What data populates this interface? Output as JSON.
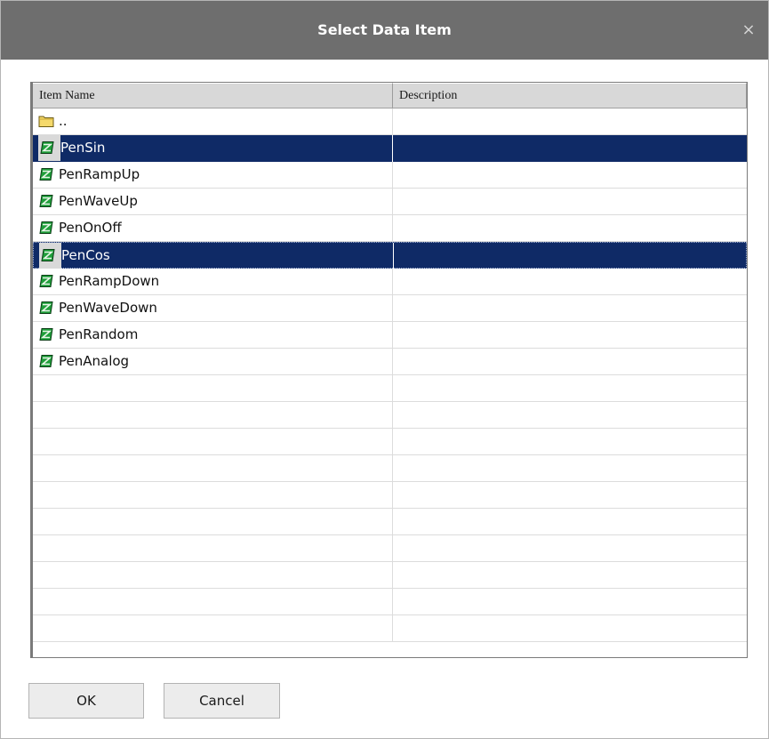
{
  "window": {
    "title": "Select Data Item",
    "close_glyph": "×"
  },
  "colors": {
    "titlebar": "#6e6e6e",
    "selection": "#0f2a66",
    "folder_icon": "#f5d96b",
    "item_icon": "#1f9e3a"
  },
  "list": {
    "columns": [
      "Item Name",
      "Description"
    ],
    "rows": [
      {
        "icon": "folder-icon",
        "name": "..",
        "description": "",
        "selected": false
      },
      {
        "icon": "data-item-icon",
        "name": "PenSin",
        "description": "",
        "selected": true
      },
      {
        "icon": "data-item-icon",
        "name": "PenRampUp",
        "description": "",
        "selected": false
      },
      {
        "icon": "data-item-icon",
        "name": "PenWaveUp",
        "description": "",
        "selected": false
      },
      {
        "icon": "data-item-icon",
        "name": "PenOnOff",
        "description": "",
        "selected": false
      },
      {
        "icon": "data-item-icon",
        "name": "PenCos",
        "description": "",
        "selected": true
      },
      {
        "icon": "data-item-icon",
        "name": "PenRampDown",
        "description": "",
        "selected": false
      },
      {
        "icon": "data-item-icon",
        "name": "PenWaveDown",
        "description": "",
        "selected": false
      },
      {
        "icon": "data-item-icon",
        "name": "PenRandom",
        "description": "",
        "selected": false
      },
      {
        "icon": "data-item-icon",
        "name": "PenAnalog",
        "description": "",
        "selected": false
      }
    ]
  },
  "buttons": {
    "ok": "OK",
    "cancel": "Cancel"
  }
}
